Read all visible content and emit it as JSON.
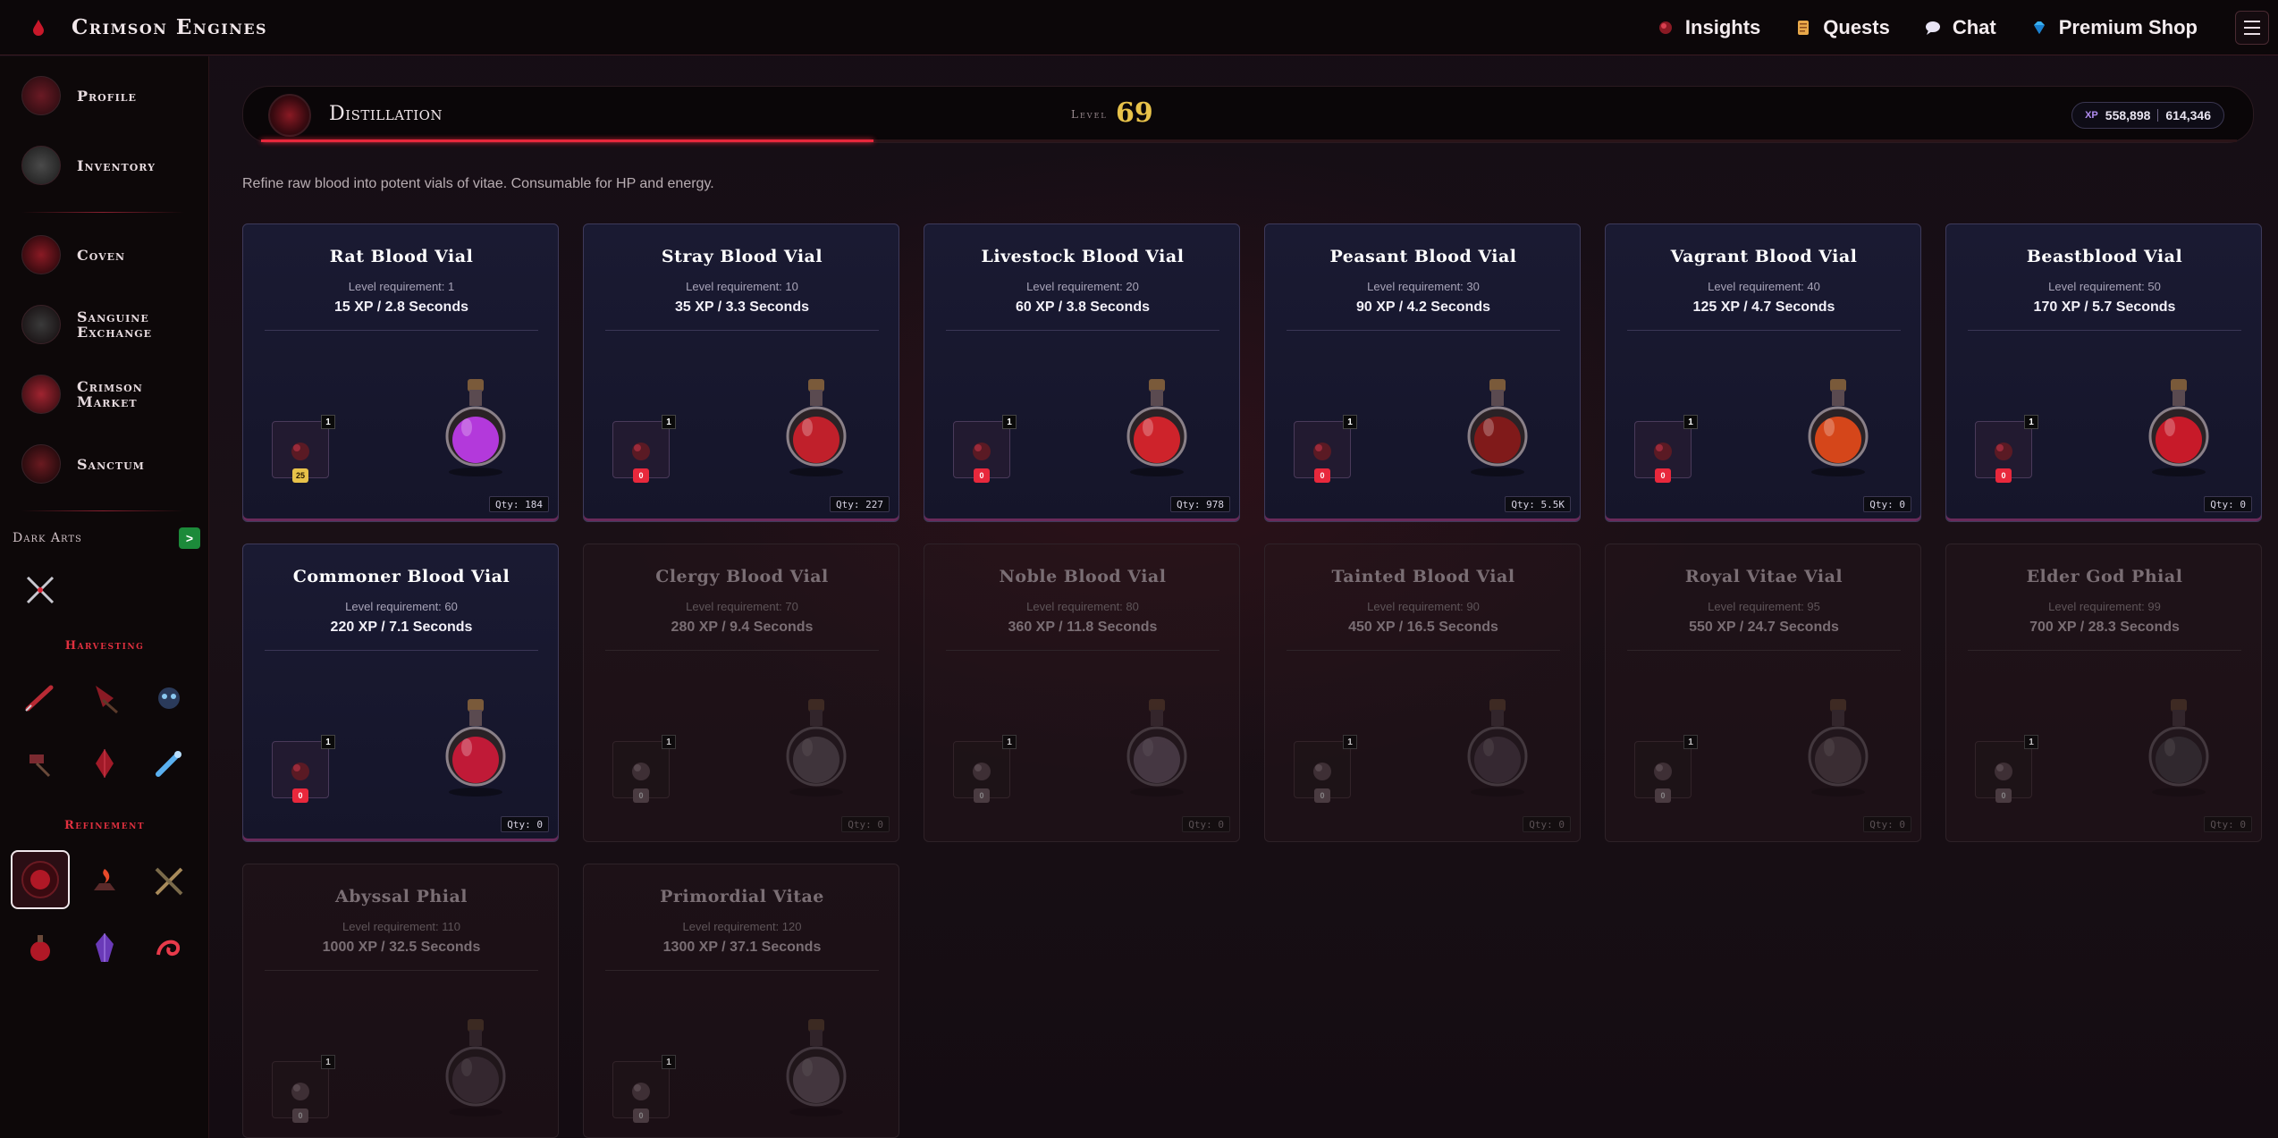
{
  "app": {
    "brand": "Crimson Engines"
  },
  "nav": {
    "insights": "Insights",
    "quests": "Quests",
    "chat": "Chat",
    "premium_shop": "Premium Shop"
  },
  "sidebar": {
    "items": [
      {
        "label": "Profile"
      },
      {
        "label": "Inventory"
      },
      {
        "label": "Coven"
      },
      {
        "label": "Sanguine Exchange"
      },
      {
        "label": "Crimson Market"
      },
      {
        "label": "Sanctum"
      }
    ],
    "dark_arts_label": "Dark Arts",
    "dark_arts_toggle": ">",
    "harvesting_label": "Harvesting",
    "refinement_label": "Refinement"
  },
  "header": {
    "title": "Distillation",
    "level_label": "Level",
    "level_value": "69",
    "xp_tag": "XP",
    "xp_current": "558,898",
    "xp_next": "614,346",
    "progress_fraction": 0.31
  },
  "description": "Refine raw blood into potent vials of vitae. Consumable for HP and energy.",
  "recipes": [
    {
      "title": "Rat Blood Vial",
      "req": "Level requirement: 1",
      "xp": "15 XP / 2.8 Seconds",
      "qty": "Qty: 184",
      "ing_count": "1",
      "ing_stock": "25",
      "stock_style": "gold",
      "locked": false,
      "liquid": "#c23cf0"
    },
    {
      "title": "Stray Blood Vial",
      "req": "Level requirement: 10",
      "xp": "35 XP / 3.3 Seconds",
      "qty": "Qty: 227",
      "ing_count": "1",
      "ing_stock": "0",
      "stock_style": "red",
      "locked": false,
      "liquid": "#d0202c"
    },
    {
      "title": "Livestock Blood Vial",
      "req": "Level requirement: 20",
      "xp": "60 XP / 3.8 Seconds",
      "qty": "Qty: 978",
      "ing_count": "1",
      "ing_stock": "0",
      "stock_style": "red",
      "locked": false,
      "liquid": "#e0242c"
    },
    {
      "title": "Peasant Blood Vial",
      "req": "Level requirement: 30",
      "xp": "90 XP / 4.2 Seconds",
      "qty": "Qty: 5.5K",
      "ing_count": "1",
      "ing_stock": "0",
      "stock_style": "red",
      "locked": false,
      "liquid": "#8a1a1a"
    },
    {
      "title": "Vagrant Blood Vial",
      "req": "Level requirement: 40",
      "xp": "125 XP / 4.7 Seconds",
      "qty": "Qty: 0",
      "ing_count": "1",
      "ing_stock": "0",
      "stock_style": "red",
      "locked": false,
      "liquid": "#e84a1a"
    },
    {
      "title": "Beastblood Vial",
      "req": "Level requirement: 50",
      "xp": "170 XP / 5.7 Seconds",
      "qty": "Qty: 0",
      "ing_count": "1",
      "ing_stock": "0",
      "stock_style": "red",
      "locked": false,
      "liquid": "#d81a2a"
    },
    {
      "title": "Commoner Blood Vial",
      "req": "Level requirement: 60",
      "xp": "220 XP / 7.1 Seconds",
      "qty": "Qty: 0",
      "ing_count": "1",
      "ing_stock": "0",
      "stock_style": "red",
      "locked": false,
      "liquid": "#d01a3a"
    },
    {
      "title": "Clergy Blood Vial",
      "req": "Level requirement: 70",
      "xp": "280 XP / 9.4 Seconds",
      "qty": "Qty: 0",
      "ing_count": "1",
      "ing_stock": "0",
      "stock_style": "red",
      "locked": true,
      "liquid": "#8a8088"
    },
    {
      "title": "Noble Blood Vial",
      "req": "Level requirement: 80",
      "xp": "360 XP / 11.8 Seconds",
      "qty": "Qty: 0",
      "ing_count": "1",
      "ing_stock": "0",
      "stock_style": "red",
      "locked": true,
      "liquid": "#9a8aa0"
    },
    {
      "title": "Tainted Blood Vial",
      "req": "Level requirement: 90",
      "xp": "450 XP / 16.5 Seconds",
      "qty": "Qty: 0",
      "ing_count": "1",
      "ing_stock": "0",
      "stock_style": "red",
      "locked": true,
      "liquid": "#6a5a68"
    },
    {
      "title": "Royal Vitae Vial",
      "req": "Level requirement: 95",
      "xp": "550 XP / 24.7 Seconds",
      "qty": "Qty: 0",
      "ing_count": "1",
      "ing_stock": "0",
      "stock_style": "red",
      "locked": true,
      "liquid": "#7a6a70"
    },
    {
      "title": "Elder God Phial",
      "req": "Level requirement: 99",
      "xp": "700 XP / 28.3 Seconds",
      "qty": "Qty: 0",
      "ing_count": "1",
      "ing_stock": "0",
      "stock_style": "red",
      "locked": true,
      "liquid": "#5a5a60"
    },
    {
      "title": "Abyssal Phial",
      "req": "Level requirement: 110",
      "xp": "1000 XP / 32.5 Seconds",
      "qty": "",
      "ing_count": "1",
      "ing_stock": "0",
      "stock_style": "red",
      "locked": true,
      "liquid": "#6a5a66"
    },
    {
      "title": "Primordial Vitae",
      "req": "Level requirement: 120",
      "xp": "1300 XP / 37.1 Seconds",
      "qty": "",
      "ing_count": "1",
      "ing_stock": "0",
      "stock_style": "red",
      "locked": true,
      "liquid": "#9a8a96"
    }
  ]
}
